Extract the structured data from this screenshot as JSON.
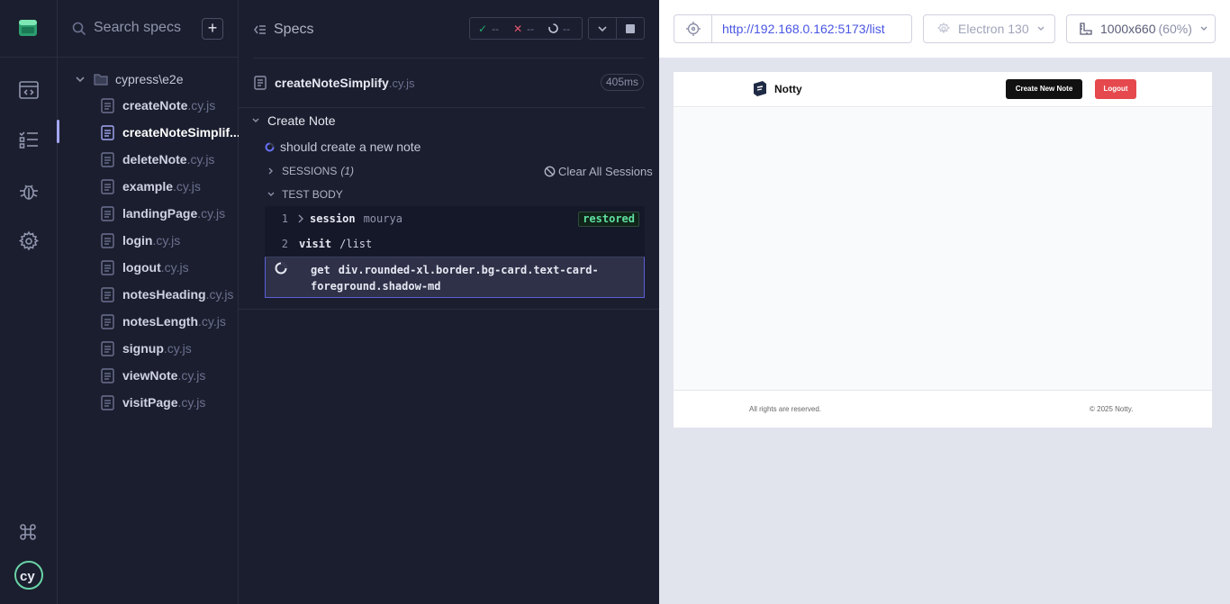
{
  "nav": {
    "items": [
      {
        "name": "specs-nav-icon"
      },
      {
        "name": "runs-nav-icon"
      },
      {
        "name": "debug-nav-icon"
      },
      {
        "name": "settings-nav-icon"
      }
    ]
  },
  "search": {
    "placeholder": "Search specs",
    "add_label": "+"
  },
  "tree": {
    "folder": "cypress\\e2e",
    "specs": [
      {
        "name": "createNote",
        "ext": ".cy.js"
      },
      {
        "name": "createNoteSimplif...",
        "ext": ""
      },
      {
        "name": "deleteNote",
        "ext": ".cy.js"
      },
      {
        "name": "example",
        "ext": ".cy.js"
      },
      {
        "name": "landingPage",
        "ext": ".cy.js"
      },
      {
        "name": "login",
        "ext": ".cy.js"
      },
      {
        "name": "logout",
        "ext": ".cy.js"
      },
      {
        "name": "notesHeading",
        "ext": ".cy.js"
      },
      {
        "name": "notesLength",
        "ext": ".cy.js"
      },
      {
        "name": "signup",
        "ext": ".cy.js"
      },
      {
        "name": "viewNote",
        "ext": ".cy.js"
      },
      {
        "name": "visitPage",
        "ext": ".cy.js"
      }
    ]
  },
  "reporter": {
    "title": "Specs",
    "stats": {
      "passed": "--",
      "failed": "--",
      "pending": "--"
    },
    "spec": {
      "name": "createNoteSimplify",
      "ext": ".cy.js",
      "duration": "405ms"
    },
    "suite": "Create Note",
    "test": "should create a new note",
    "sessions_label": "SESSIONS",
    "sessions_count": "(1)",
    "clear_sessions": "Clear All Sessions",
    "test_body": "TEST BODY",
    "commands": [
      {
        "num": "1",
        "name": "session",
        "msg": "mourya",
        "badge": "restored"
      },
      {
        "num": "2",
        "name": "visit",
        "msg": "/list"
      }
    ],
    "active_command": {
      "name": "get",
      "msg_line1": "div.rounded-xl.border.bg-card.text-card-",
      "msg_line2": "foreground.shadow-md"
    }
  },
  "aut": {
    "url": "http://192.168.0.162:5173/list",
    "browser": "Electron 130",
    "viewport": "1000x660",
    "viewport_pct": "(60%)",
    "app": {
      "name": "Notty",
      "create_button": "Create New Note",
      "logout_button": "Logout",
      "footer_left": "All rights are reserved.",
      "footer_right": "© 2025 Notty."
    }
  },
  "colors": {
    "pass": "#1fa971",
    "fail": "#e45770",
    "accent": "#a3a7f5",
    "logout": "#e5484d"
  }
}
